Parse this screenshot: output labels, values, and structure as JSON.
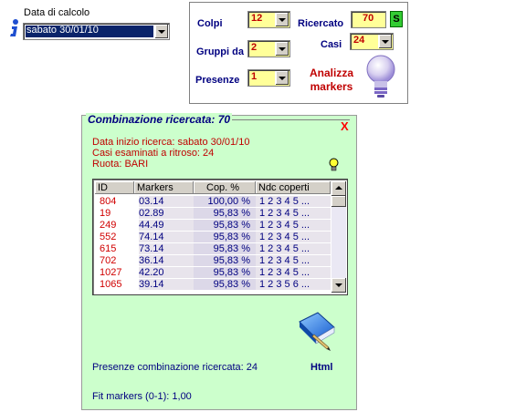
{
  "date": {
    "label": "Data di calcolo",
    "value": "sabato 30/01/10"
  },
  "settings": {
    "colpi_label": "Colpi",
    "colpi_value": "12",
    "ricercato_label": "Ricercato",
    "ricercato_value": "70",
    "s_button": "S",
    "gruppi_label": "Gruppi da",
    "gruppi_value": "2",
    "casi_label": "Casi",
    "casi_value": "24",
    "presenze_label": "Presenze",
    "presenze_value": "1",
    "analizza_line1": "Analizza",
    "analizza_line2": "markers"
  },
  "result": {
    "title": "Combinazione ricercata: 70",
    "close": "X",
    "info_line1": "Data inizio ricerca: sabato 30/01/10",
    "info_line2": "Casi esaminati a ritroso: 24",
    "info_line3": "Ruota: BARI",
    "columns": [
      "ID",
      "Markers",
      "Cop. %",
      "Ndc coperti"
    ],
    "rows": [
      [
        "804",
        "03.14",
        "100,00 %",
        "1 2 3 4 5 ..."
      ],
      [
        "19",
        "02.89",
        "95,83 %",
        "1 2 3 4 5 ..."
      ],
      [
        "249",
        "44.49",
        "95,83 %",
        "1 2 3 4 5 ..."
      ],
      [
        "552",
        "74.14",
        "95,83 %",
        "1 2 3 4 5 ..."
      ],
      [
        "615",
        "73.14",
        "95,83 %",
        "1 2 3 4 5 ..."
      ],
      [
        "702",
        "36.14",
        "95,83 %",
        "1 2 3 4 5 ..."
      ],
      [
        "1027",
        "42.20",
        "95,83 %",
        "1 2 3 4 5 ..."
      ],
      [
        "1065",
        "39.14",
        "95,83 %",
        "1 2 3 5 6 ..."
      ]
    ],
    "html_label": "Html",
    "presenze_text": "Presenze combinazione ricercata: 24",
    "fit_text": "Fit markers (0-1): 1,00"
  },
  "colors": {
    "panel_bg": "#ccffcc",
    "title": "#000080",
    "accent_red": "#c00000",
    "combo_yellow": "#ffff99",
    "s_button": "#33cc33"
  },
  "icons": [
    "info-icon",
    "chevron-down-icon",
    "lightbulb-icon",
    "book-icon",
    "close-icon"
  ]
}
